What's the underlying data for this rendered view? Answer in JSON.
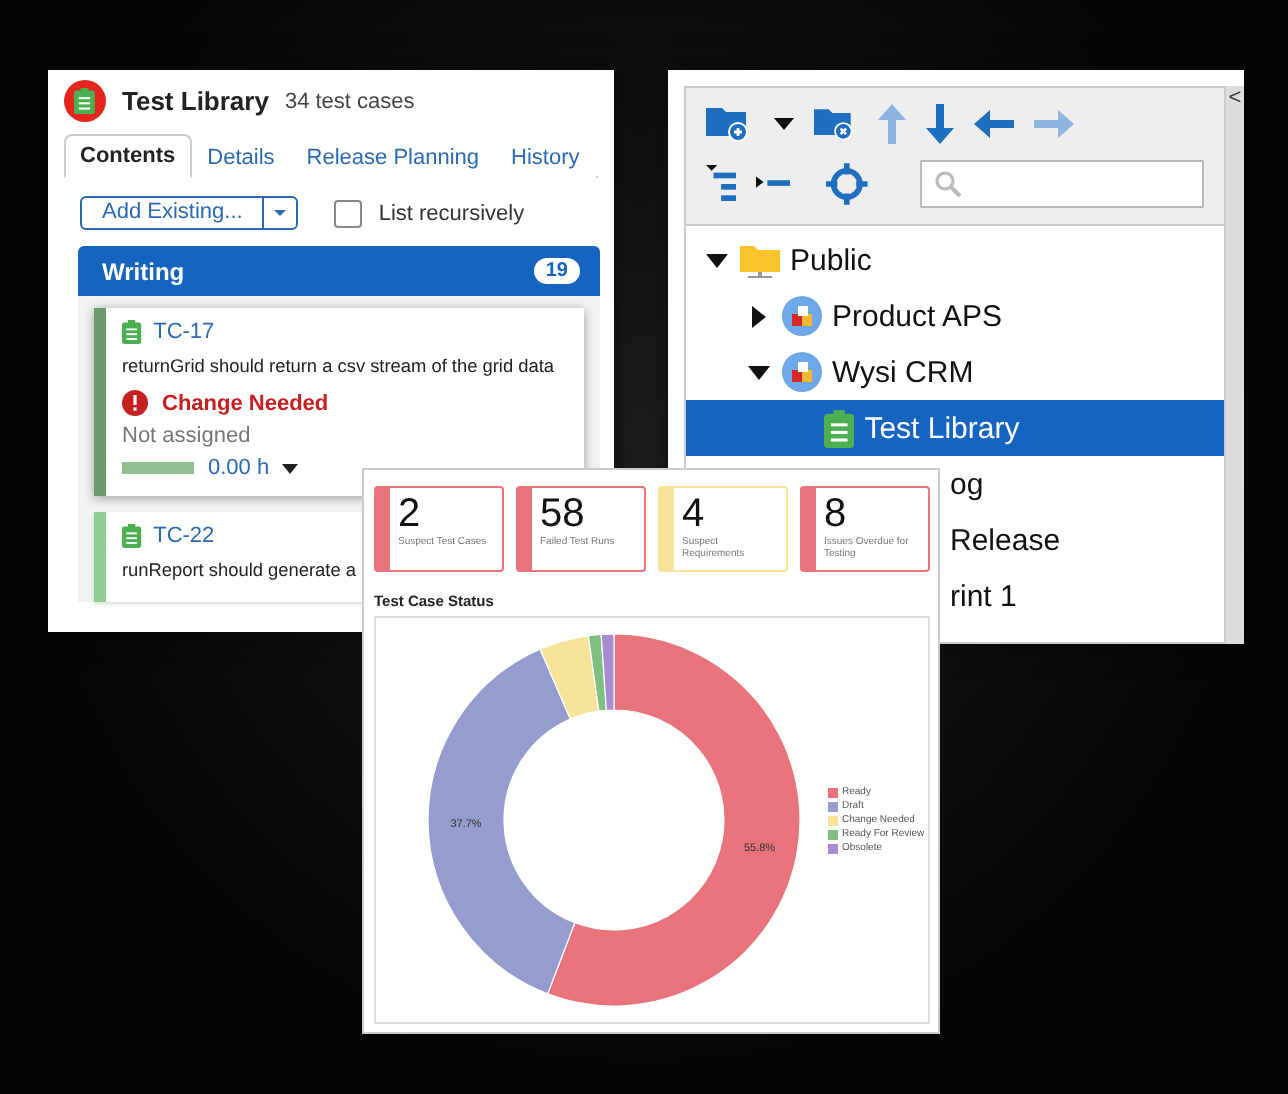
{
  "library_window": {
    "title": "Test Library",
    "subtitle": "34 test cases",
    "tabs": [
      {
        "label": "Contents",
        "selected": true
      },
      {
        "label": "Details",
        "selected": false
      },
      {
        "label": "Release Planning",
        "selected": false
      },
      {
        "label": "History",
        "selected": false
      }
    ],
    "add_button": "Add Existing...",
    "recursive": {
      "label": "List recursively",
      "checked": false
    },
    "group": {
      "title": "Writing",
      "count": "19"
    },
    "cards": [
      {
        "id": "TC-17",
        "title": "returnGrid should return a csv stream of the grid data",
        "status": "Change Needed",
        "assignee": "Not assigned",
        "hours": "0.00 h",
        "focused": true
      },
      {
        "id": "TC-22",
        "title": "runReport should generate a",
        "focused": false
      }
    ]
  },
  "tree_window": {
    "scroll_label": "<",
    "tree": [
      {
        "label": "Public",
        "kind": "folder",
        "expanded": true,
        "selected": false,
        "children": [
          {
            "label": "Product APS",
            "kind": "project",
            "expanded": false,
            "selected": false
          },
          {
            "label": "Wysi CRM",
            "kind": "project",
            "expanded": true,
            "selected": false,
            "children": [
              {
                "label": "Test Library",
                "kind": "library",
                "selected": true
              }
            ]
          }
        ]
      }
    ],
    "covered_rows": [
      "og",
      "Release",
      "rint 1"
    ]
  },
  "dashboard": {
    "tiles": [
      {
        "value": "2",
        "label": "Suspect Test Cases",
        "color": "#e8737a"
      },
      {
        "value": "58",
        "label": "Failed Test Runs",
        "color": "#e8737a"
      },
      {
        "value": "4",
        "label": "Suspect Requirements",
        "color": "#f8e39a"
      },
      {
        "value": "8",
        "label": "Issues Overdue for Testing",
        "color": "#e8737a"
      }
    ],
    "chart_data": {
      "type": "donut",
      "title": "Test Case Status",
      "categories": [
        "Ready",
        "Draft",
        "Change Needed",
        "Ready For Review",
        "Obsolete"
      ],
      "series": [
        {
          "values": [
            55.8,
            37.7,
            4.3,
            1.1,
            1.1
          ]
        }
      ],
      "colors": [
        "#e8737a",
        "#959dce",
        "#f8e39a",
        "#7fbf7f",
        "#a98bd0"
      ],
      "value_labels": [
        "55.8%",
        "37.7%",
        null,
        null,
        null
      ]
    }
  }
}
